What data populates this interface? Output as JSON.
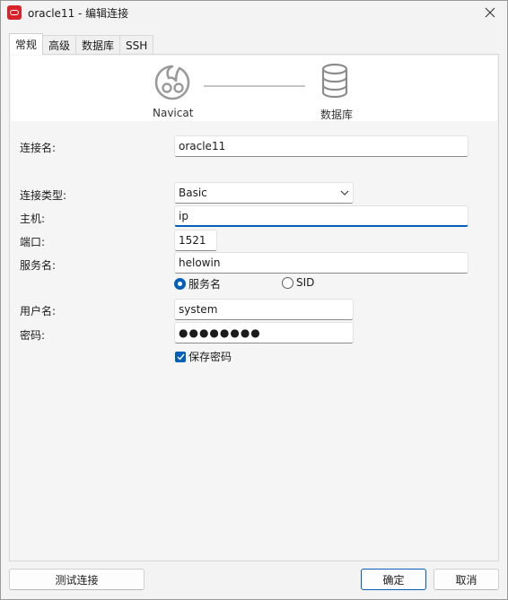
{
  "window": {
    "title": "oracle11 - 编辑连接"
  },
  "tabs": [
    {
      "label": "常规",
      "active": true
    },
    {
      "label": "高级",
      "active": false
    },
    {
      "label": "数据库",
      "active": false
    },
    {
      "label": "SSH",
      "active": false
    }
  ],
  "banner": {
    "left_label": "Navicat",
    "right_label": "数据库"
  },
  "form": {
    "connection_name": {
      "label": "连接名:",
      "value": "oracle11"
    },
    "connection_type": {
      "label": "连接类型:",
      "value": "Basic"
    },
    "host": {
      "label": "主机:",
      "value": "ip"
    },
    "port": {
      "label": "端口:",
      "value": "1521"
    },
    "service_name": {
      "label": "服务名:",
      "value": "helowin"
    },
    "service_mode": {
      "options": [
        "服务名",
        "SID"
      ],
      "selected": "服务名"
    },
    "username": {
      "label": "用户名:",
      "value": "system"
    },
    "password": {
      "label": "密码:",
      "value": "●●●●●●●●"
    },
    "save_password": {
      "label": "保存密码",
      "checked": true
    }
  },
  "buttons": {
    "test": "测试连接",
    "ok": "确定",
    "cancel": "取消"
  },
  "colors": {
    "accent": "#005fb8",
    "app_icon": "#d8232a"
  }
}
